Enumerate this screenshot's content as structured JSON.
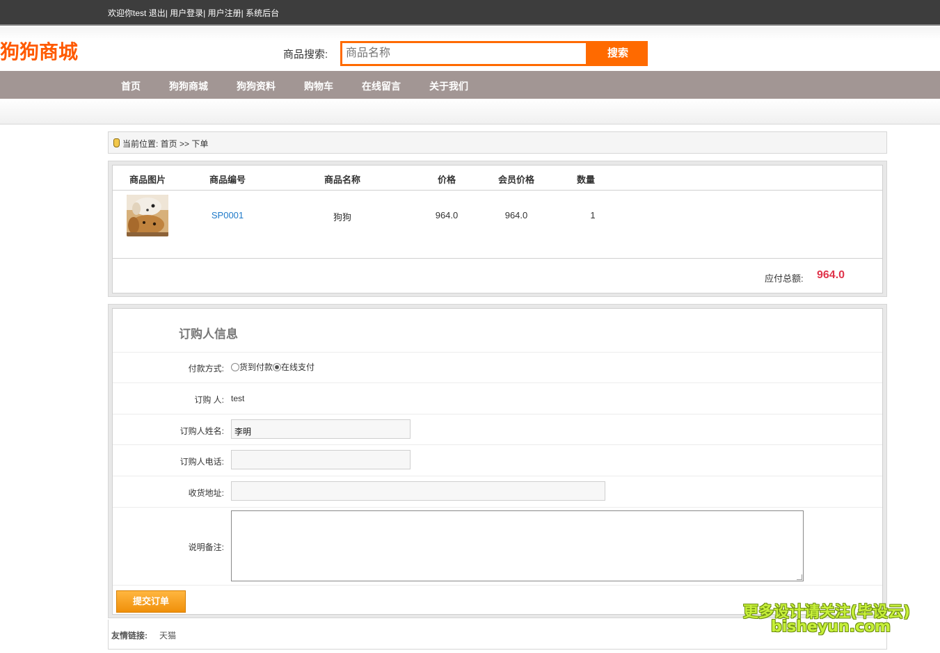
{
  "topbar": {
    "welcome": "欢迎你test",
    "logout": "退出",
    "login": "用户登录",
    "register": "用户注册",
    "admin": "系统后台"
  },
  "header": {
    "logo": "狗狗商城",
    "search_label": "商品搜索:",
    "search_placeholder": "商品名称",
    "search_button": "搜索"
  },
  "nav": {
    "items": [
      {
        "label": "首页"
      },
      {
        "label": "狗狗商城"
      },
      {
        "label": "狗狗资料"
      },
      {
        "label": "购物车"
      },
      {
        "label": "在线留言"
      },
      {
        "label": "关于我们"
      }
    ]
  },
  "breadcrumb": {
    "text": "当前位置: 首页 >> 下单"
  },
  "order": {
    "columns": [
      "商品图片",
      "商品编号",
      "商品名称",
      "价格",
      "会员价格",
      "数量"
    ],
    "rows": [
      {
        "image": "dog-photo",
        "code": "SP0001",
        "name": "狗狗",
        "price": "964.0",
        "member_price": "964.0",
        "quantity": "1"
      }
    ],
    "total_label": "应付总额:",
    "total_value": "964.0"
  },
  "form": {
    "title": "订购人信息",
    "payment_label": "付款方式:",
    "payment_options": [
      "货到付款",
      "在线支付"
    ],
    "payment_selected": "在线支付",
    "buyer_label": "订购 人:",
    "buyer_value": "test",
    "name_label": "订购人姓名:",
    "name_value": "李明",
    "phone_label": "订购人电话:",
    "phone_value": "",
    "address_label": "收货地址:",
    "address_value": "",
    "remark_label": "说明备注:",
    "remark_value": "",
    "submit_label": "提交订单"
  },
  "footer": {
    "links_label": "友情链接:",
    "links": [
      "天猫"
    ]
  },
  "watermark": {
    "line1": "更多设计请关注(毕设云)",
    "line2": "bisheyun.com"
  },
  "colors": {
    "brand_orange": "#ff6a00",
    "nav_bg": "#a29694",
    "price_red": "#e0344b",
    "link_blue": "#1f7ac9"
  }
}
